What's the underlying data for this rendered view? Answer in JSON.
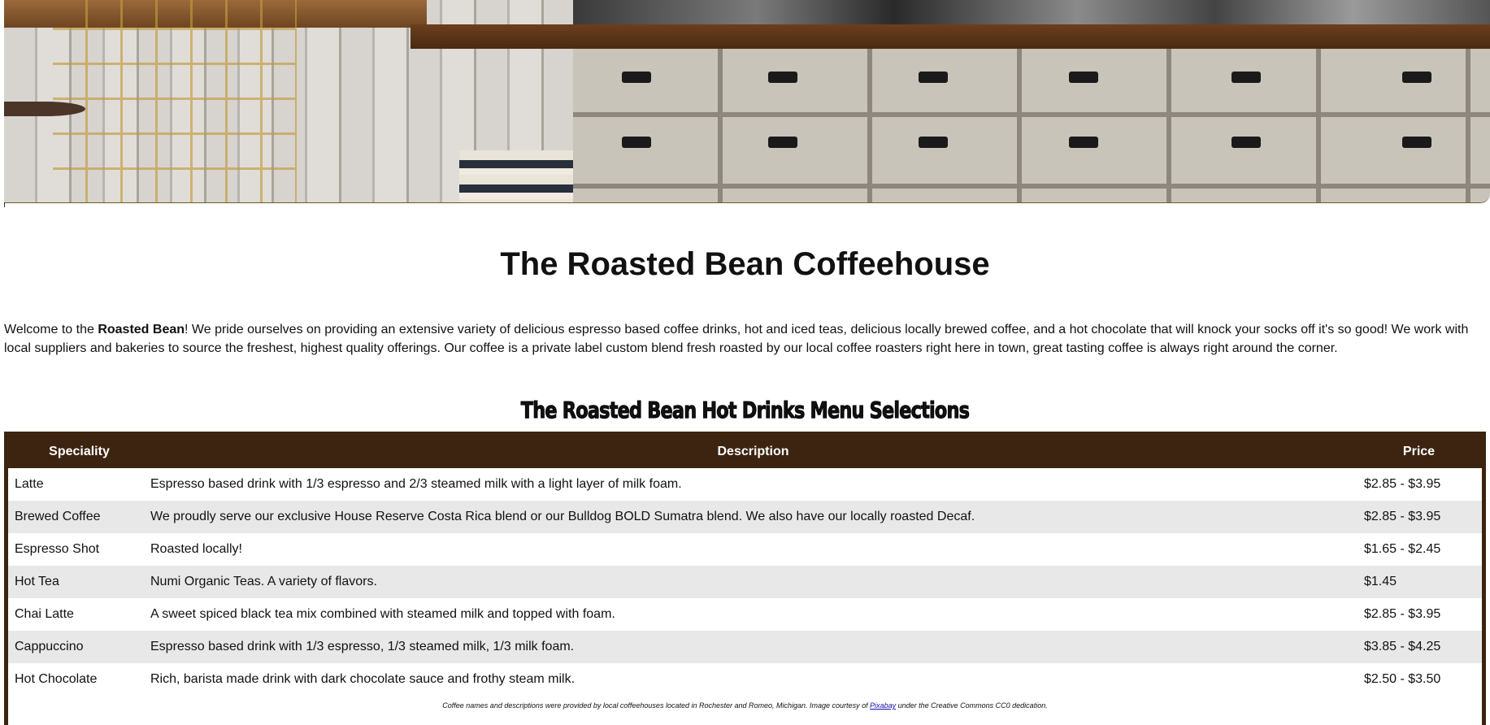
{
  "hero": {
    "image_alt": "Coffeehouse counter with drawers and a wire chair"
  },
  "page": {
    "title": "The Roasted Bean Coffeehouse",
    "intro_prefix": "Welcome to the ",
    "intro_bold": "Roasted Bean",
    "intro_rest": "! We pride ourselves on providing an extensive variety of delicious espresso based coffee drinks, hot and iced teas, delicious locally brewed coffee, and a hot chocolate that will knock your socks off it's so good! We work with local suppliers and bakeries to source the freshest, highest quality offerings. Our coffee is a private label custom blend fresh roasted by our local coffee roasters right here in town, great tasting coffee is always right around the corner."
  },
  "menu": {
    "heading": "The Roasted Bean Hot Drinks Menu Selections",
    "columns": {
      "speciality": "Speciality",
      "description": "Description",
      "price": "Price"
    },
    "rows": [
      {
        "speciality": "Latte",
        "description": "Espresso based drink with 1/3 espresso and 2/3 steamed milk with a light layer of milk foam.",
        "price": "$2.85 - $3.95"
      },
      {
        "speciality": "Brewed Coffee",
        "description": "We proudly serve our exclusive House Reserve Costa Rica blend or our Bulldog BOLD Sumatra blend. We also have our locally roasted Decaf.",
        "price": "$2.85 - $3.95"
      },
      {
        "speciality": "Espresso Shot",
        "description": "Roasted locally!",
        "price": "$1.65 - $2.45"
      },
      {
        "speciality": "Hot Tea",
        "description": "Numi Organic Teas. A variety of flavors.",
        "price": "$1.45"
      },
      {
        "speciality": "Chai Latte",
        "description": "A sweet spiced black tea mix combined with steamed milk and topped with foam.",
        "price": "$2.85 - $3.95"
      },
      {
        "speciality": "Cappuccino",
        "description": "Espresso based drink with 1/3 espresso, 1/3 steamed milk, 1/3 milk foam.",
        "price": "$3.85 - $4.25"
      },
      {
        "speciality": "Hot Chocolate",
        "description": "Rich, barista made drink with dark chocolate sauce and frothy steam milk.",
        "price": "$2.50 - $3.50"
      }
    ],
    "footnote_prefix": "Coffee names and descriptions were provided by local coffeehouses located in Rochester and Romeo, Michigan. Image courtesy of ",
    "footnote_link": "Pixabay",
    "footnote_suffix": " under the Creative Commons CC0 dedication."
  },
  "colors": {
    "table_header_bg": "#3d2410",
    "table_border": "#3d2410",
    "alt_row_bg": "#e8e8e8",
    "link": "#1a0dab"
  }
}
